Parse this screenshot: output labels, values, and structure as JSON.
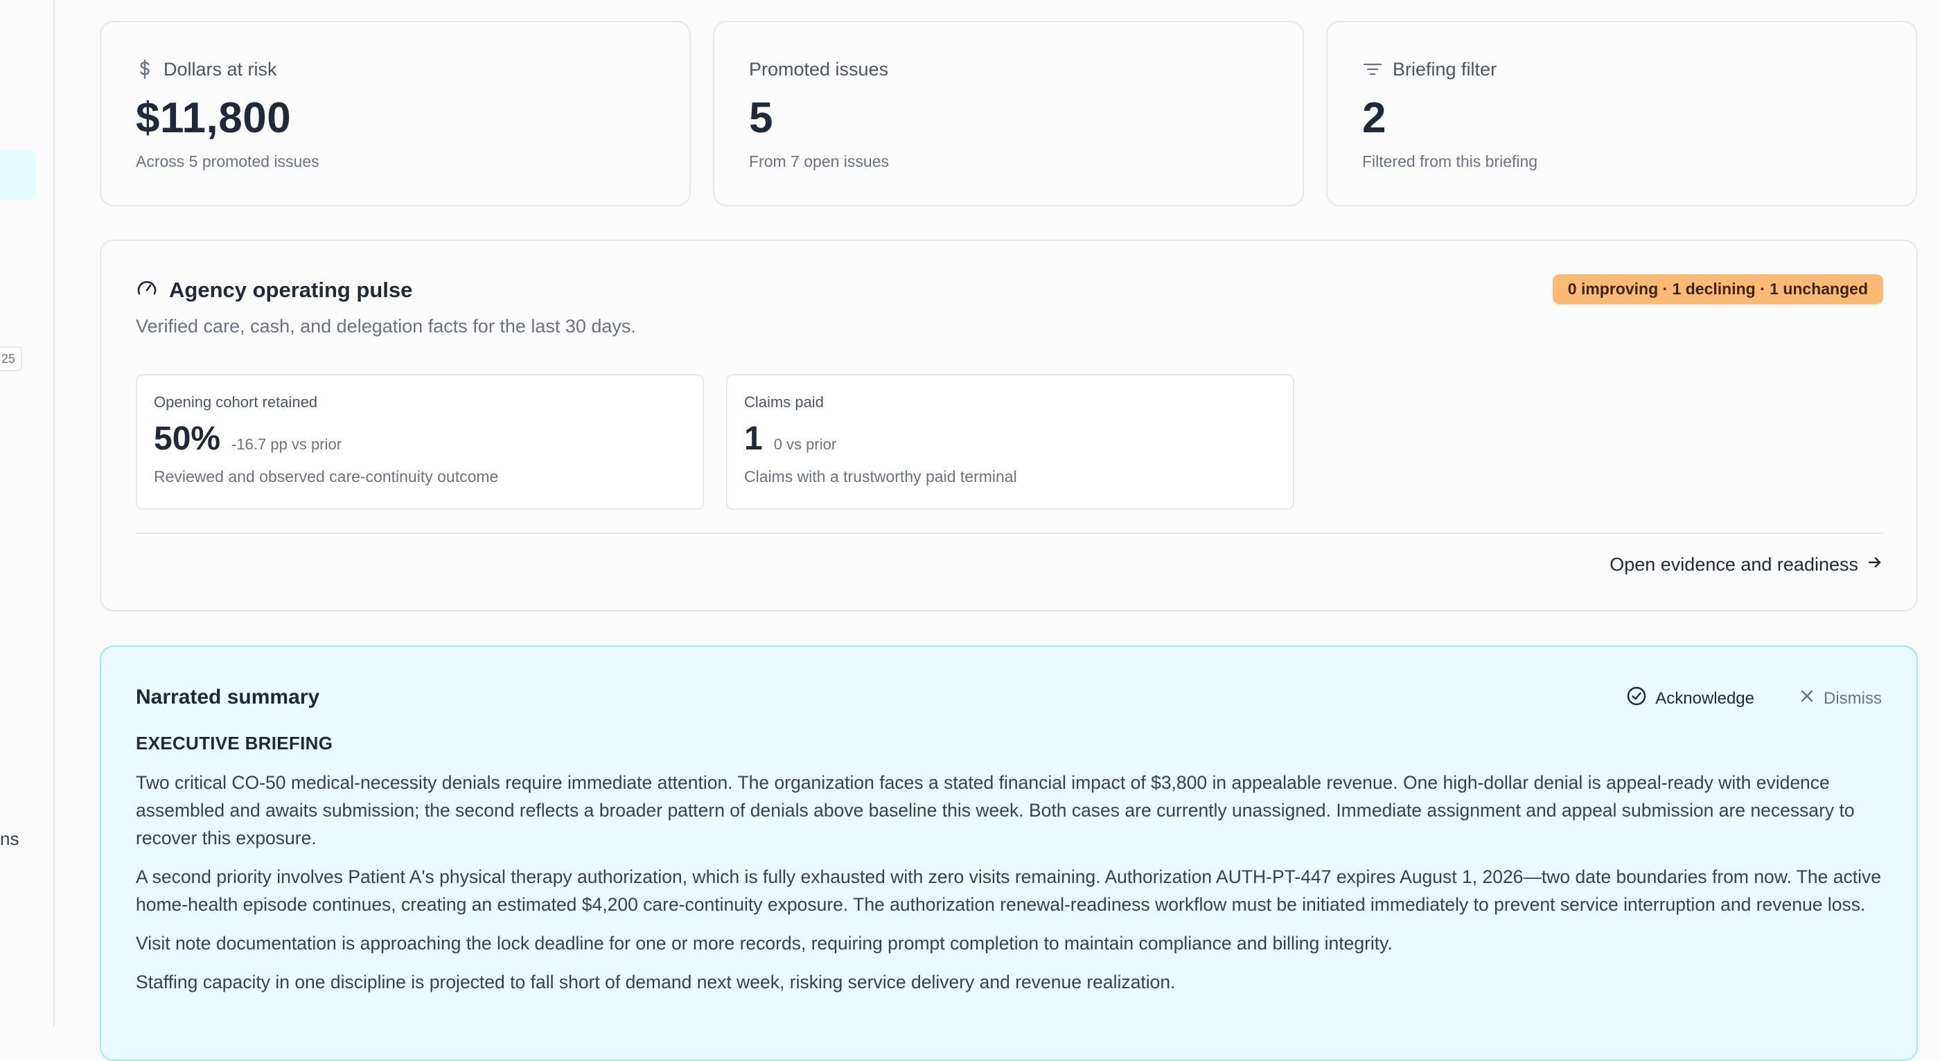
{
  "sidebar": {
    "badge_fragment": "25",
    "label_fragment": "ns"
  },
  "kpis": [
    {
      "label": "Dollars at risk",
      "value": "$11,800",
      "sub": "Across 5 promoted issues",
      "icon": "dollar-icon"
    },
    {
      "label": "Promoted issues",
      "value": "5",
      "sub": "From 7 open issues",
      "icon": null
    },
    {
      "label": "Briefing filter",
      "value": "2",
      "sub": "Filtered from this briefing",
      "icon": "filter-icon"
    }
  ],
  "pulse": {
    "title": "Agency operating pulse",
    "subtitle": "Verified care, cash, and delegation facts for the last 30 days.",
    "trend_badge": "0 improving · 1 declining · 1 unchanged",
    "trend_badge_color": "#fdba74",
    "metrics": [
      {
        "label": "Opening cohort retained",
        "value": "50%",
        "delta": "-16.7 pp vs prior",
        "note": "Reviewed and observed care-continuity outcome"
      },
      {
        "label": "Claims paid",
        "value": "1",
        "delta": "0 vs prior",
        "note": "Claims with a trustworthy paid terminal"
      }
    ],
    "evidence_link": "Open evidence and readiness"
  },
  "summary": {
    "title": "Narrated summary",
    "acknowledge_label": "Acknowledge",
    "dismiss_label": "Dismiss",
    "heading": "EXECUTIVE BRIEFING",
    "paragraphs": [
      "Two critical CO-50 medical-necessity denials require immediate attention. The organization faces a stated financial impact of $3,800 in appealable revenue. One high-dollar denial is appeal-ready with evidence assembled and awaits submission; the second reflects a broader pattern of denials above baseline this week. Both cases are currently unassigned. Immediate assignment and appeal submission are necessary to recover this exposure.",
      "A second priority involves Patient A's physical therapy authorization, which is fully exhausted with zero visits remaining. Authorization AUTH-PT-447 expires August 1, 2026—two date boundaries from now. The active home-health episode continues, creating an estimated $4,200 care-continuity exposure. The authorization renewal-readiness workflow must be initiated immediately to prevent service interruption and revenue loss.",
      "Visit note documentation is approaching the lock deadline for one or more records, requiring prompt completion to maintain compliance and billing integrity.",
      "Staffing capacity in one discipline is projected to fall short of demand next week, risking service delivery and revenue realization."
    ]
  },
  "colors": {
    "summary_bg": "#e9fbfd",
    "summary_border": "#a5e9f0",
    "accent_active": "#e6fbfd"
  }
}
